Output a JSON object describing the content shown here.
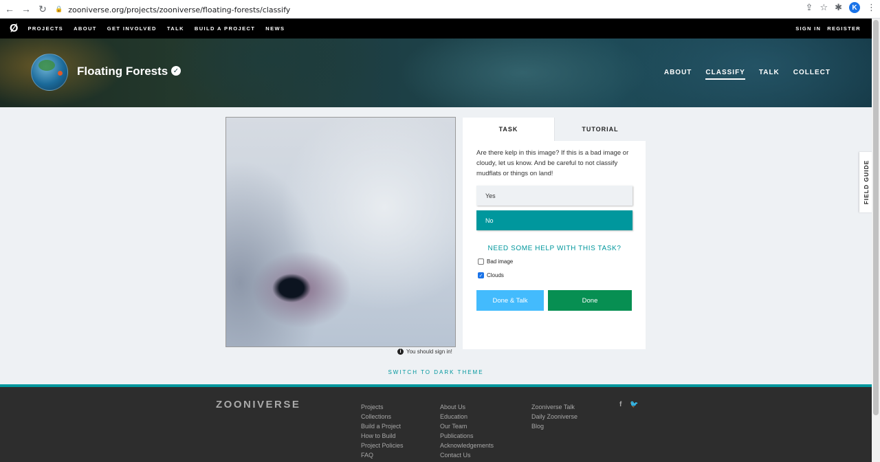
{
  "browser": {
    "url": "zooniverse.org/projects/zooniverse/floating-forests/classify",
    "profile_initial": "K"
  },
  "topnav": {
    "items": [
      "PROJECTS",
      "ABOUT",
      "GET INVOLVED",
      "TALK",
      "BUILD A PROJECT",
      "NEWS"
    ],
    "sign_in": "SIGN IN",
    "register": "REGISTER"
  },
  "project": {
    "title": "Floating Forests",
    "nav": [
      "ABOUT",
      "CLASSIFY",
      "TALK",
      "COLLECT"
    ]
  },
  "panel": {
    "tabs": [
      "TASK",
      "TUTORIAL"
    ],
    "question": "Are there kelp in this image? If this is a bad image or cloudy, let us know. And be careful to not classify mudflats or things on land!",
    "answers": [
      "Yes",
      "No"
    ],
    "help": "NEED SOME HELP WITH THIS TASK?",
    "checks": [
      {
        "label": "Bad image",
        "checked": false
      },
      {
        "label": "Clouds",
        "checked": true
      }
    ],
    "done_talk": "Done & Talk",
    "done": "Done"
  },
  "signin_note": "You should sign in!",
  "field_guide": "FIELD GUIDE",
  "theme_switch": "SWITCH TO DARK THEME",
  "footer": {
    "logo": "ZOONIVERSE",
    "col1": [
      "Projects",
      "Collections",
      "Build a Project",
      "How to Build",
      "Project Policies",
      "FAQ"
    ],
    "col2": [
      "About Us",
      "Education",
      "Our Team",
      "Publications",
      "Acknowledgements",
      "Contact Us"
    ],
    "col3": [
      "Zooniverse Talk",
      "Daily Zooniverse",
      "Blog"
    ]
  },
  "colors": {
    "accent": "#00979d",
    "done": "#078f52",
    "done_talk": "#43bbfd"
  }
}
